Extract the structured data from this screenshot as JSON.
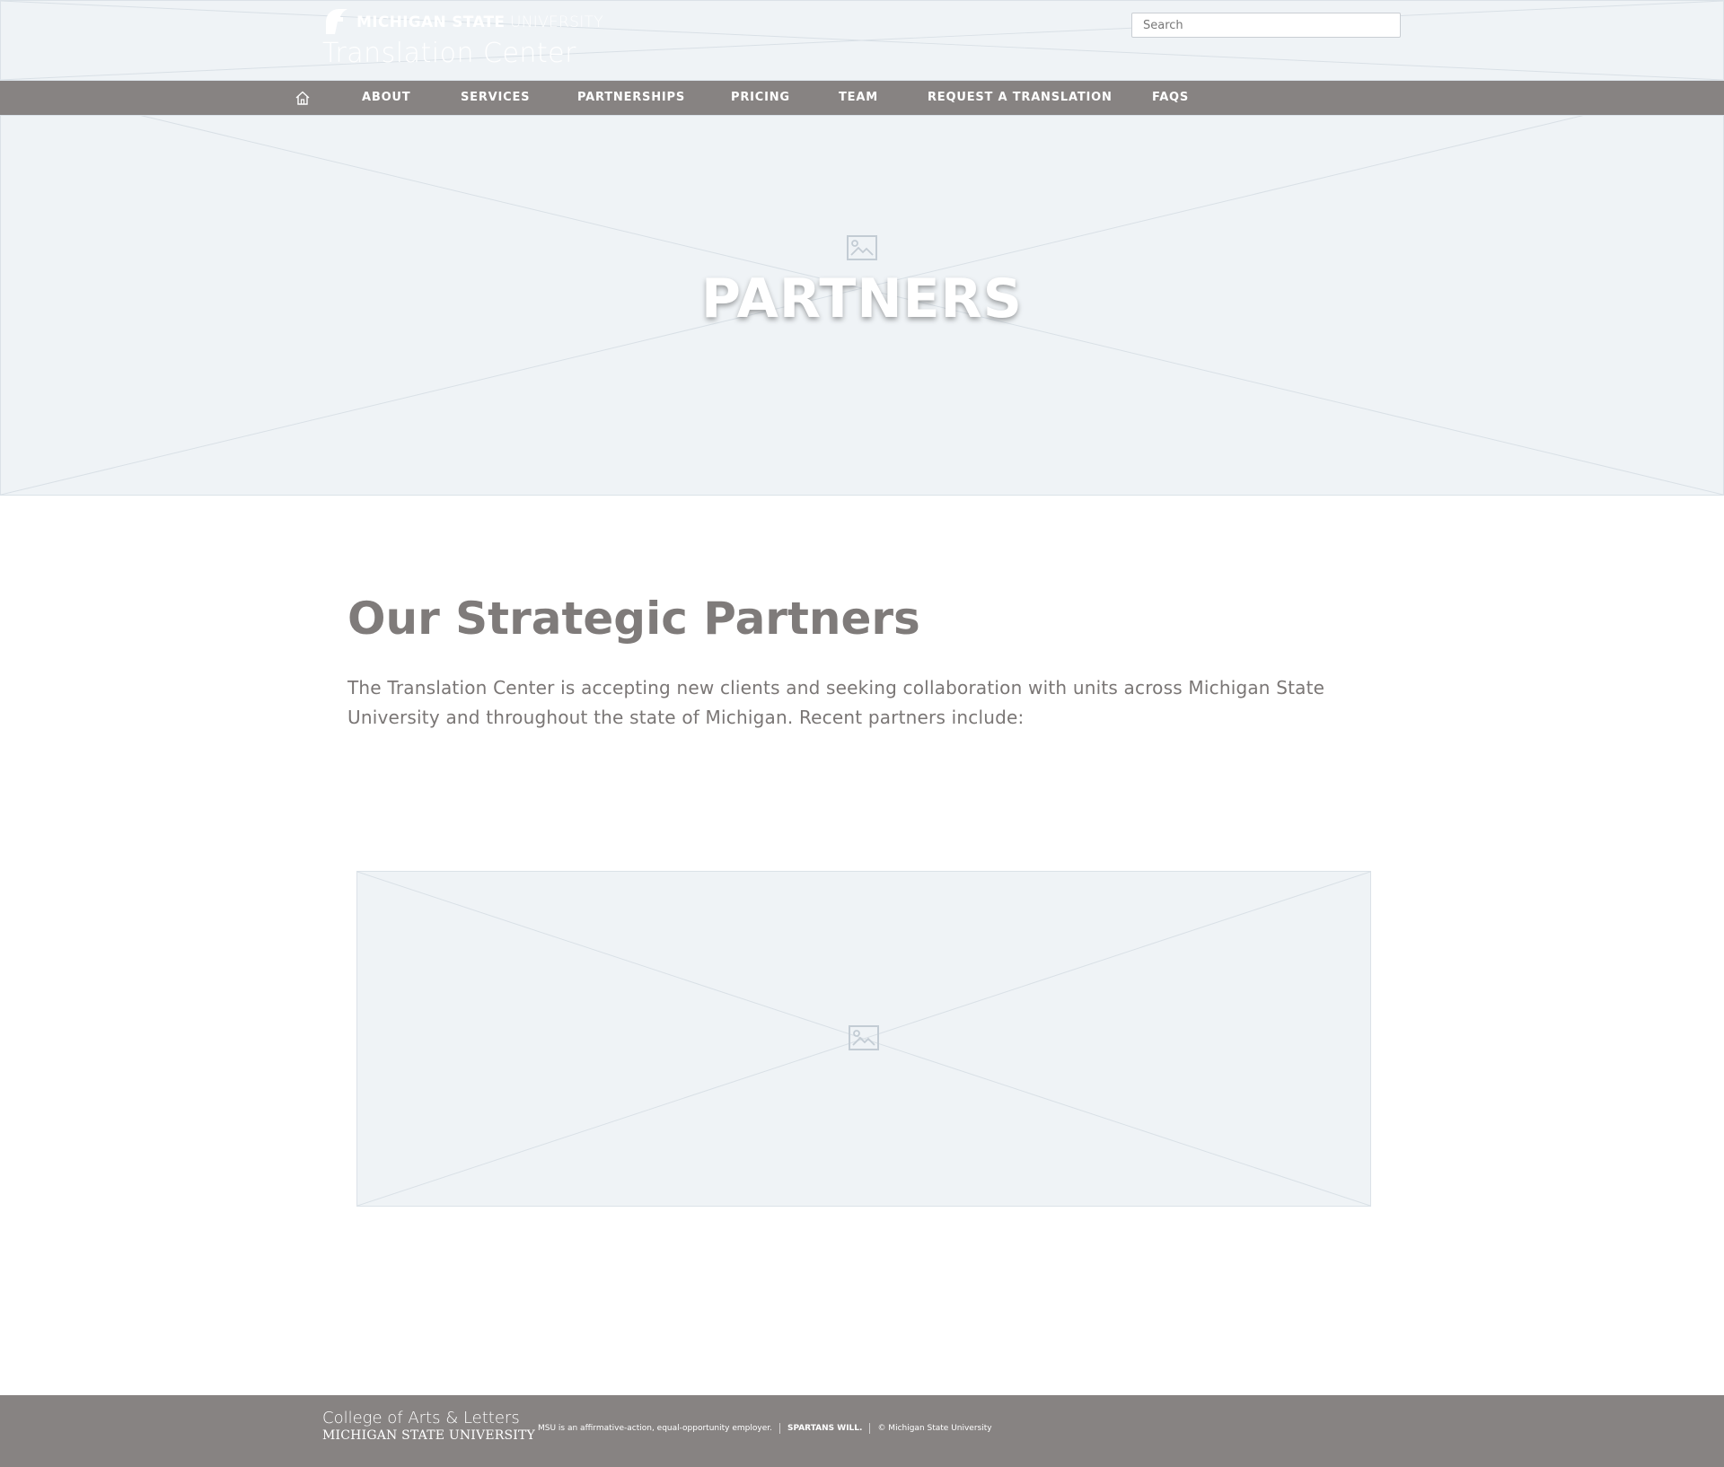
{
  "header": {
    "msu_wordmark_bold": "MICHIGAN STATE",
    "msu_wordmark_light": "UNIVERSITY",
    "site_title": "Translation Center",
    "search_placeholder": "Search"
  },
  "nav": {
    "items": [
      {
        "label": "ABOUT"
      },
      {
        "label": "SERVICES"
      },
      {
        "label": "PARTNERSHIPS"
      },
      {
        "label": "PRICING"
      },
      {
        "label": "TEAM"
      },
      {
        "label": "REQUEST A TRANSLATION"
      },
      {
        "label": "FAQS"
      }
    ]
  },
  "hero": {
    "title": "PARTNERS"
  },
  "main": {
    "heading": "Our Strategic Partners",
    "intro": "The Translation Center is accepting new clients and seeking collaboration with units across Michigan State University and throughout the state of Michigan. Recent partners include:"
  },
  "footer": {
    "college": "College of Arts & Letters",
    "msu": "MICHIGAN STATE UNIVERSITY",
    "eeo": "MSU is an affirmative-action, equal-opportunity employer.",
    "spartans_will": "SPARTANS WILL.",
    "copyright": "© Michigan State University"
  },
  "colors": {
    "nav_bg": "#878382",
    "footer_bg": "#878382",
    "placeholder_bg": "#eff3f6",
    "heading_text": "#7f7b7a",
    "body_text": "#7a7675"
  },
  "icons": [
    "spartan-helmet-icon",
    "home-icon",
    "image-placeholder-icon"
  ]
}
